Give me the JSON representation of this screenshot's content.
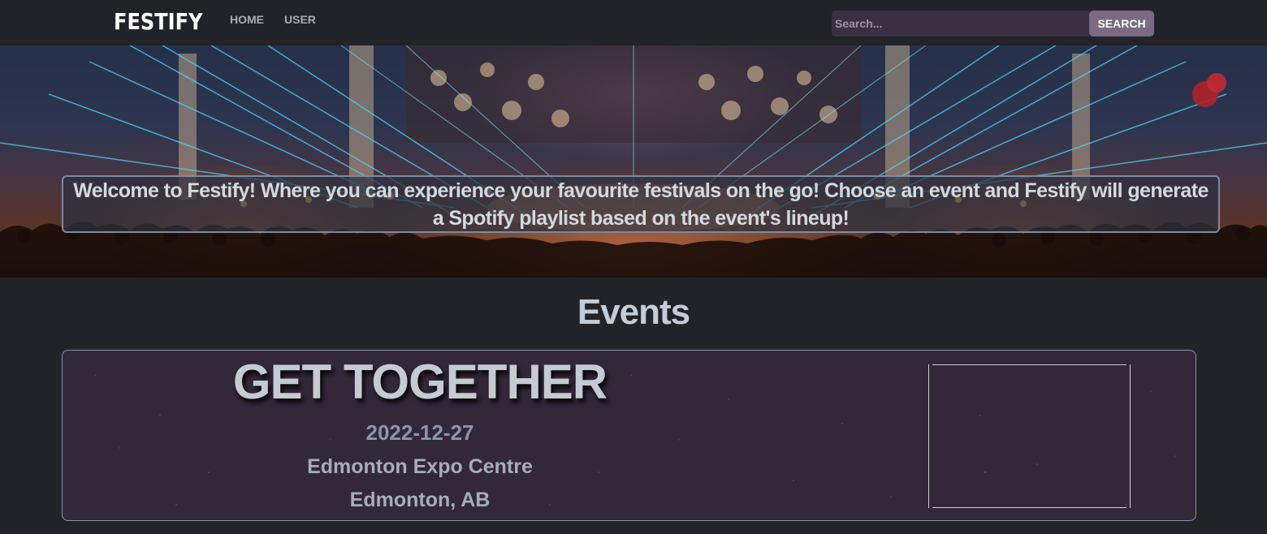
{
  "navbar": {
    "brand": "FESTIFY",
    "links": [
      "HOME",
      "USER"
    ],
    "search": {
      "placeholder": "Search...",
      "value": "",
      "button_label": "SEARCH"
    }
  },
  "hero": {
    "welcome": "Welcome to Festify! Where you can experience your favourite festivals on the go! Choose an event and Festify will generate a Spotify playlist based on the event's lineup!"
  },
  "events": {
    "heading": "Events",
    "items": [
      {
        "name": "GET TOGETHER",
        "date": "2022-12-27",
        "venue": "Edmonton Expo Centre",
        "city": "Edmonton, AB"
      }
    ]
  },
  "colors": {
    "background": "#222328",
    "search_input": "#3b2f44",
    "search_button": "#7b6a82",
    "card_background": "#33273a",
    "card_border": "#8793a8"
  }
}
